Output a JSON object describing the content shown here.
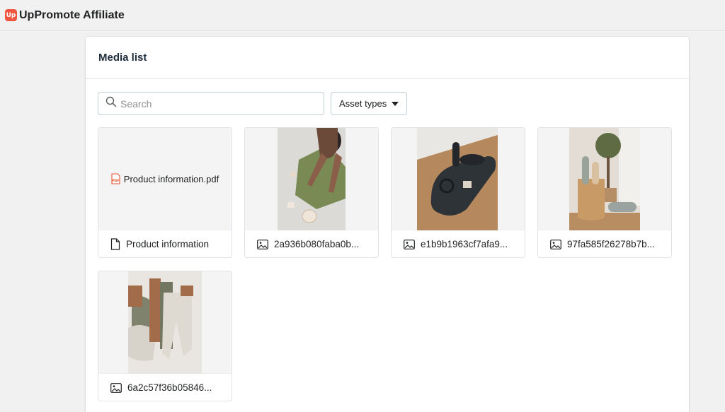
{
  "app": {
    "logo_text": "Up",
    "title": "UpPromote Affiliate"
  },
  "media": {
    "title": "Media list",
    "search": {
      "placeholder": "Search",
      "value": ""
    },
    "asset_filter_label": "Asset types",
    "items": [
      {
        "type": "file",
        "preview_label": "Product information.pdf",
        "name": "Product information"
      },
      {
        "type": "image",
        "name": "2a936b080faba0b..."
      },
      {
        "type": "image",
        "name": "e1b9b1963cf7afa9..."
      },
      {
        "type": "image",
        "name": "97fa585f26278b7b..."
      },
      {
        "type": "image",
        "name": "6a2c57f36b05846..."
      }
    ]
  },
  "colors": {
    "brand": "#f0533e",
    "pdf_red": "#e8542f",
    "text": "#202223",
    "border": "#c4cdd5"
  }
}
